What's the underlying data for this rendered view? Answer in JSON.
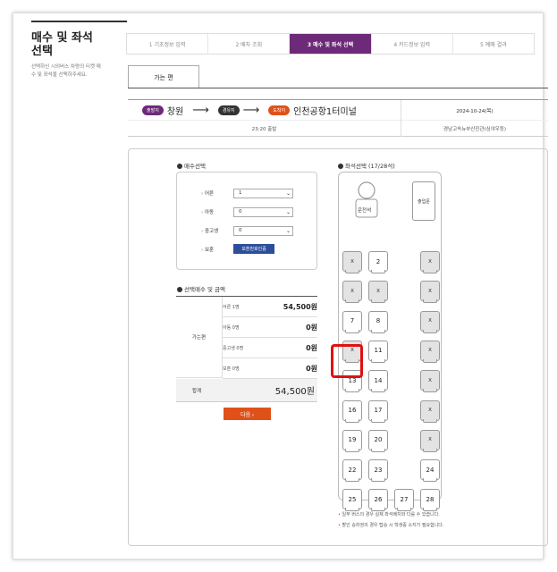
{
  "sidebar": {
    "title_line1": "매수 및 좌석",
    "title_line2": "선택",
    "desc_line1": "선택하신 시외버스 차량의 티켓 매",
    "desc_line2": "수 및 좌석을 선택하주세요."
  },
  "steps": [
    {
      "label": "1 기초정보 입력"
    },
    {
      "label": "2 배차 조회"
    },
    {
      "label": "3 매수 및 좌석 선택"
    },
    {
      "label": "4 카드정보 입력"
    },
    {
      "label": "5 예매 결과"
    }
  ],
  "tab": {
    "label": "가는 편"
  },
  "route": {
    "dep_badge": "출발지",
    "dep": "창원",
    "via_badge": "경유지",
    "arr_badge": "도착지",
    "arr": "인천공항1터미널",
    "date": "2024-10-24(목)",
    "time": "23:20 출발",
    "company": "경남고속뉴부산진관(심야우등)",
    "arrow": "⟶"
  },
  "qty": {
    "title": "매수선택",
    "rows": [
      {
        "label": "어른",
        "value": "1"
      },
      {
        "label": "아동",
        "value": "0"
      },
      {
        "label": "중고생",
        "value": "0"
      },
      {
        "label": "보훈"
      }
    ],
    "protect_btn": "보훈번호인증"
  },
  "fare": {
    "title": "선택매수 및 금액",
    "direction": "가는편",
    "rows": [
      {
        "label": "어른 1명",
        "value": "54,500원"
      },
      {
        "label": "아동 0명",
        "value": "0원"
      },
      {
        "label": "중고생 0명",
        "value": "0원"
      },
      {
        "label": "보훈 0명",
        "value": "0원"
      }
    ],
    "total_label": "합계",
    "total": "54,500원",
    "next": "다음 ›"
  },
  "seats": {
    "title": "좌석선택 (17/28석)",
    "driver": "운전석",
    "door": "출입문",
    "list": [
      "X",
      "2",
      "X",
      "X",
      "X",
      "X",
      "7",
      "8",
      "X",
      "X",
      "11",
      "X",
      "13",
      "14",
      "X",
      "16",
      "17",
      "X",
      "19",
      "20",
      "X",
      "22",
      "23",
      "24",
      "25",
      "26",
      "27",
      "28"
    ],
    "notes": [
      "일부 버스의 경우 실제 좌석배치와 다를 수 있습니다.",
      "할인 승차권의 경우 탑승 시 학생증 소지가 필요합니다."
    ],
    "selected": "13"
  }
}
